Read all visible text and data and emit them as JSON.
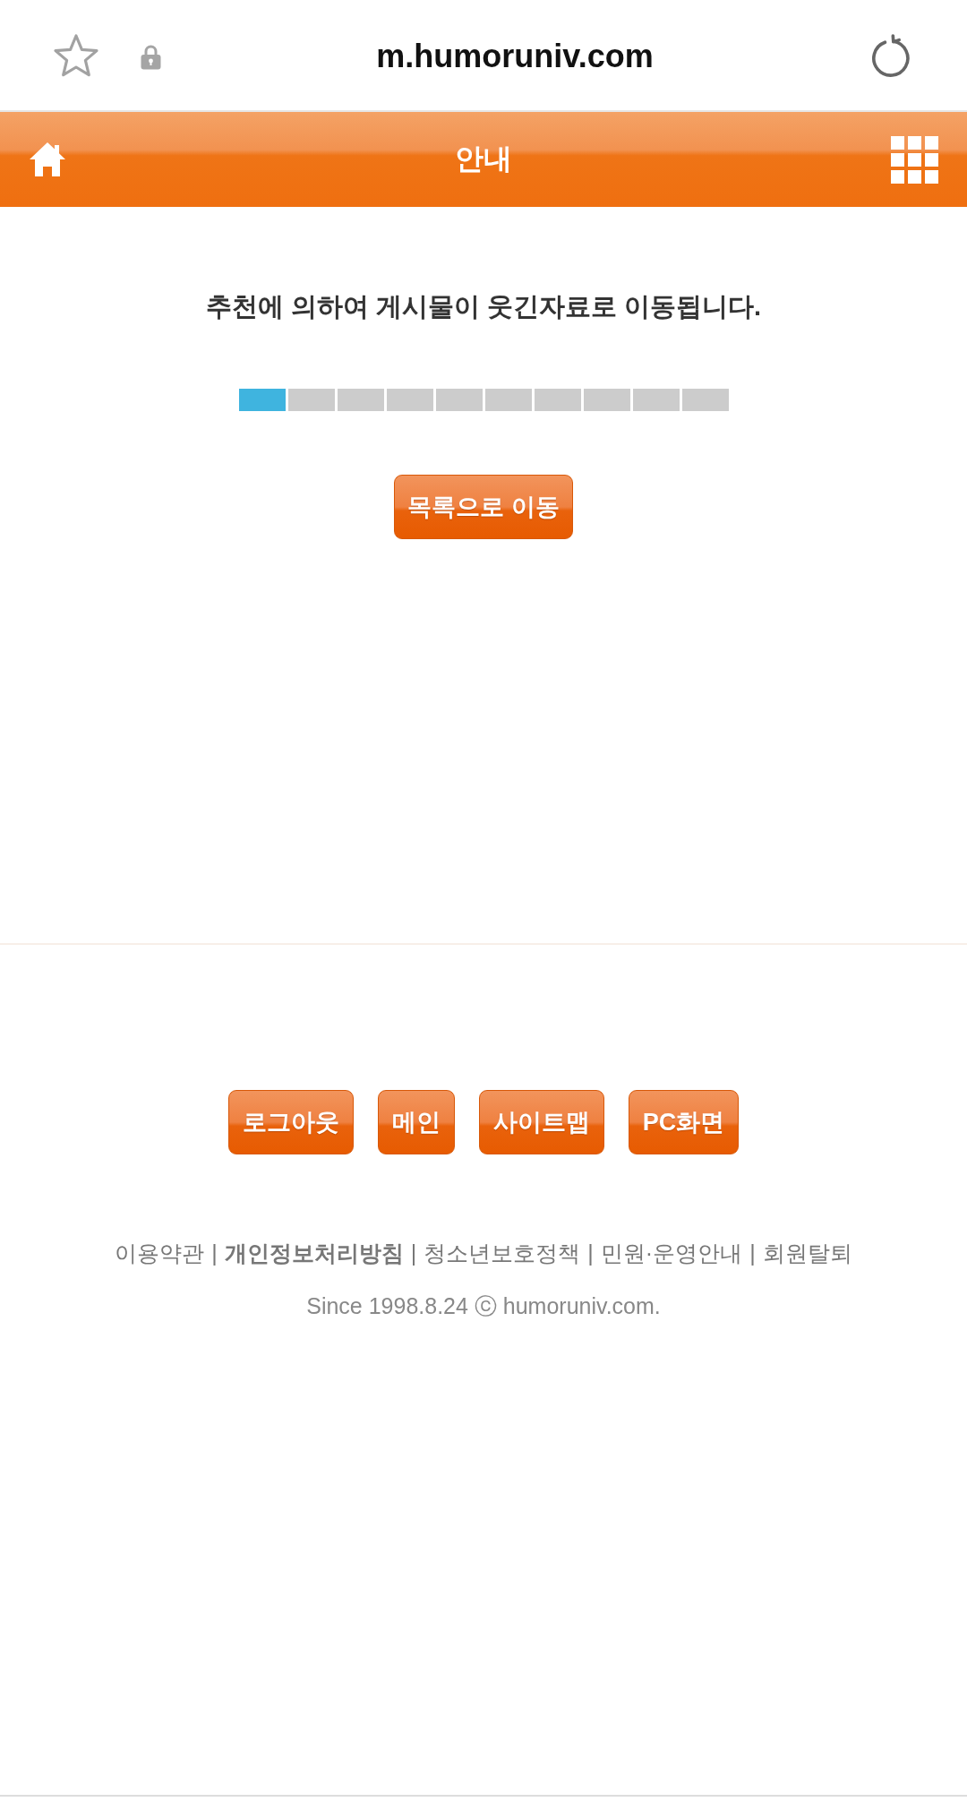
{
  "browser_bar": {
    "url": "m.humoruniv.com"
  },
  "header": {
    "title": "안내"
  },
  "notice": {
    "message": "추천에 의하여 게시물이 웃긴자료로 이동됩니다.",
    "progress": {
      "level": 0.1
    },
    "button": "목록으로 이동"
  },
  "footer": {
    "buttons": [
      "로그아웃",
      "메인",
      "사이트맵",
      "PC화면"
    ],
    "links": [
      {
        "kind": "link",
        "label": "이용약관",
        "bold": false
      },
      {
        "kind": "separator",
        "label": "|"
      },
      {
        "kind": "link",
        "label": "개인정보처리방침",
        "bold": true
      },
      {
        "kind": "separator",
        "label": "|"
      },
      {
        "kind": "link",
        "label": "청소년보호정책",
        "bold": false
      },
      {
        "kind": "separator",
        "label": "|"
      },
      {
        "kind": "link",
        "label": "민원·운영안내",
        "bold": false
      },
      {
        "kind": "separator",
        "label": "|"
      },
      {
        "kind": "link",
        "label": "회원탈퇴",
        "bold": false
      }
    ],
    "copyright": "Since 1998.8.24 ⓒ humoruniv.com."
  }
}
